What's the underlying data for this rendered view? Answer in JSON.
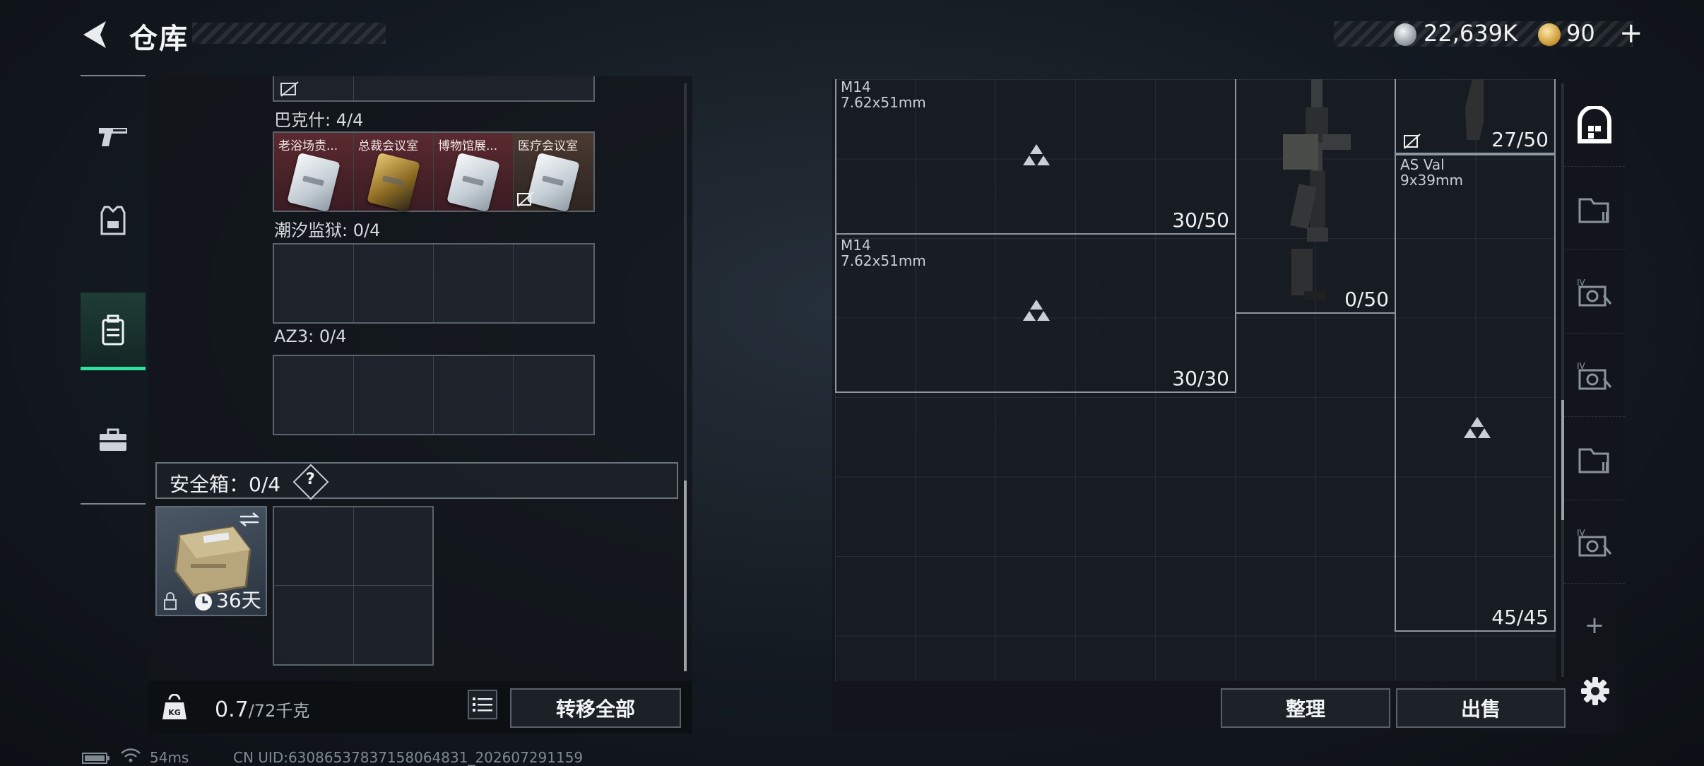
{
  "header": {
    "title": "仓库",
    "silver_amount": "22,639K",
    "gold_amount": "90",
    "plus_label": "+"
  },
  "left_nav": {
    "items": [
      {
        "name": "weapon",
        "icon": "pistol-icon"
      },
      {
        "name": "equipment",
        "icon": "vest-icon"
      },
      {
        "name": "container",
        "icon": "backpack-icon",
        "active": true
      },
      {
        "name": "toolbox",
        "icon": "briefcase-icon"
      }
    ]
  },
  "keys": {
    "bakesh": {
      "label": "巴克什: 4/4",
      "slots": [
        "老浴场责...",
        "总裁会议室",
        "博物馆展...",
        "医疗会议室"
      ]
    },
    "chaoxi": {
      "label": "潮汐监狱: 0/4"
    },
    "az3": {
      "label": "AZ3: 0/4"
    }
  },
  "safe_box": {
    "label": "安全箱：0/4",
    "help": "?",
    "duration": "36天"
  },
  "footer_left": {
    "weight_current": "0.7",
    "weight_max": "/72千克",
    "kg_label": "KG",
    "transfer_all": "转移全部"
  },
  "stash": {
    "items": [
      {
        "name": "M14",
        "caliber": "7.62x51mm",
        "count": "30/50"
      },
      {
        "name": "M14",
        "caliber": "7.62x51mm",
        "count": "30/30"
      },
      {
        "name": "",
        "caliber": "",
        "count": "0/50"
      },
      {
        "name": "",
        "caliber": "",
        "count": "27/50"
      },
      {
        "name": "AS Val",
        "caliber": "9x39mm",
        "count": "45/45"
      }
    ],
    "sort_button": "整理",
    "sell_button": "出售",
    "add_tab": "+"
  },
  "status": {
    "ping": "54ms",
    "uid": "CN UID:63086537837158064831_202607291159"
  },
  "colors": {
    "accent": "#2fe0a0",
    "key_red": "#5a2a30",
    "panel": "#12161b"
  }
}
